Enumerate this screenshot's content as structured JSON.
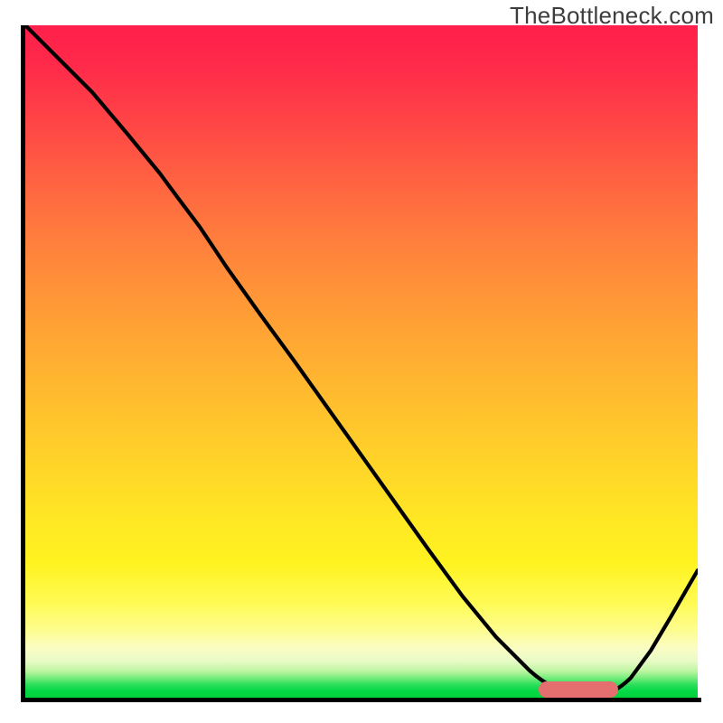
{
  "watermark": "TheBottleneck.com",
  "colors": {
    "axis": "#000000",
    "curve": "#000000",
    "marker": "#e56f6e",
    "watermark_text": "#3d3d3d"
  },
  "chart_data": {
    "type": "line",
    "title": "",
    "xlabel": "",
    "ylabel": "",
    "xlim": [
      0,
      100
    ],
    "ylim": [
      0,
      100
    ],
    "x": [
      0,
      5,
      10,
      15,
      20,
      23,
      26,
      30,
      35,
      40,
      45,
      50,
      55,
      60,
      65,
      70,
      75,
      78,
      80,
      82,
      85,
      88,
      90,
      93,
      96,
      100
    ],
    "values": [
      100,
      95,
      90,
      84,
      78,
      74,
      70,
      64,
      57,
      50,
      43,
      36,
      29,
      22,
      15,
      9,
      4,
      2,
      1,
      0,
      0,
      1,
      3,
      7,
      12,
      19
    ],
    "annotations": [
      {
        "type": "pill_marker",
        "x_start": 77,
        "x_end": 88,
        "y": 0
      }
    ],
    "notes": "Background vertical gradient runs red (y=100) → orange → yellow (~y=20) → pale yellow → green (y=0). Curve shows a V-shape with minimum near x≈82, y≈0. A rounded red-pink horizontal marker sits on the x-axis under the minimum span."
  }
}
